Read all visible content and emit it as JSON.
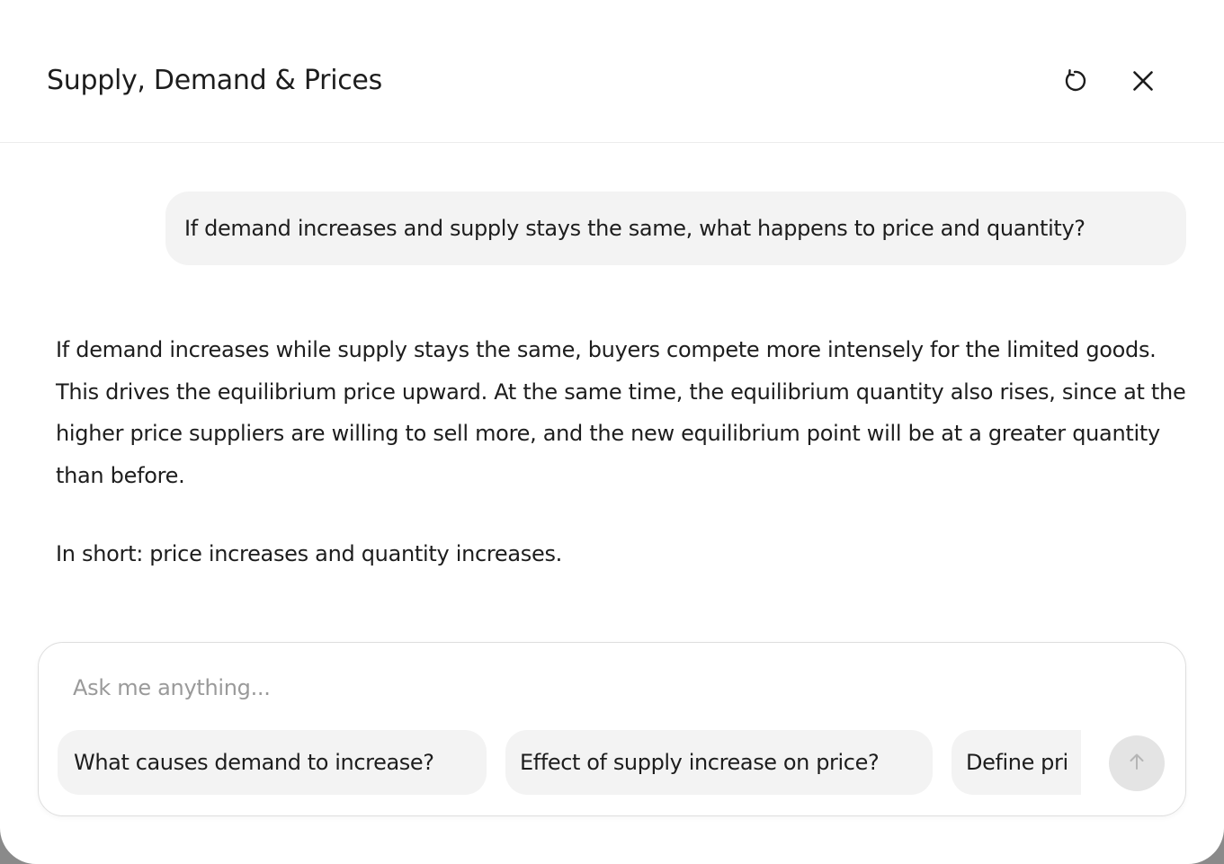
{
  "header": {
    "title": "Supply, Demand & Prices",
    "refresh_icon": "refresh-icon",
    "close_icon": "close-icon"
  },
  "conversation": {
    "user_message": "If demand increases and supply stays the same, what happens to price and quantity?",
    "assistant_paragraphs": [
      "If demand increases while supply stays the same, buyers compete more intensely for the limited goods. This drives the equilibrium price upward. At the same time, the equilibrium quantity also rises, since at the higher price suppliers are willing to sell more, and the new equilibrium point will be at a greater quantity than before.",
      "In short: price increases and quantity increases."
    ]
  },
  "composer": {
    "placeholder": "Ask me anything...",
    "value": "",
    "suggestions": [
      "What causes demand to increase?",
      "Effect of supply increase on price?",
      "Define pri"
    ],
    "send_icon": "arrow-up-icon"
  },
  "colors": {
    "bubble_bg": "#f3f3f3",
    "text": "#1d1d1d",
    "placeholder": "#9a9a9a",
    "send_button_bg": "#e4e4e4",
    "send_icon": "#b5b5b5",
    "backdrop": "#8a8a8a"
  }
}
